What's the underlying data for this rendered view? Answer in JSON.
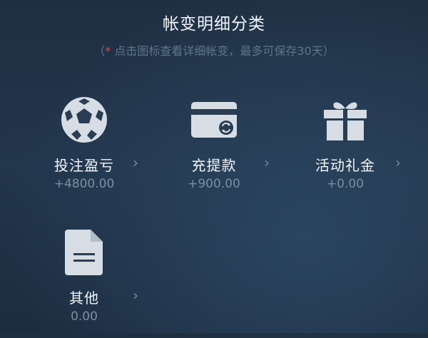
{
  "header": {
    "title": "帐变明细分类",
    "subtitle_prefix": "（",
    "subtitle_star": "*",
    "subtitle_text": " 点击图标查看详细帐变，最多可保存30天）"
  },
  "categories": [
    {
      "icon": "soccer-ball-icon",
      "label": "投注盈亏",
      "amount": "+4800.00",
      "chevron": "›"
    },
    {
      "icon": "credit-card-icon",
      "label": "充提款",
      "amount": "+900.00",
      "chevron": "›"
    },
    {
      "icon": "gift-icon",
      "label": "活动礼金",
      "amount": "+0.00",
      "chevron": "›"
    },
    {
      "icon": "document-icon",
      "label": "其他",
      "amount": "0.00",
      "chevron": "›"
    }
  ],
  "colors": {
    "icon": "#d7dde4",
    "background": "#22364c",
    "accent_star": "#d94a4a"
  }
}
